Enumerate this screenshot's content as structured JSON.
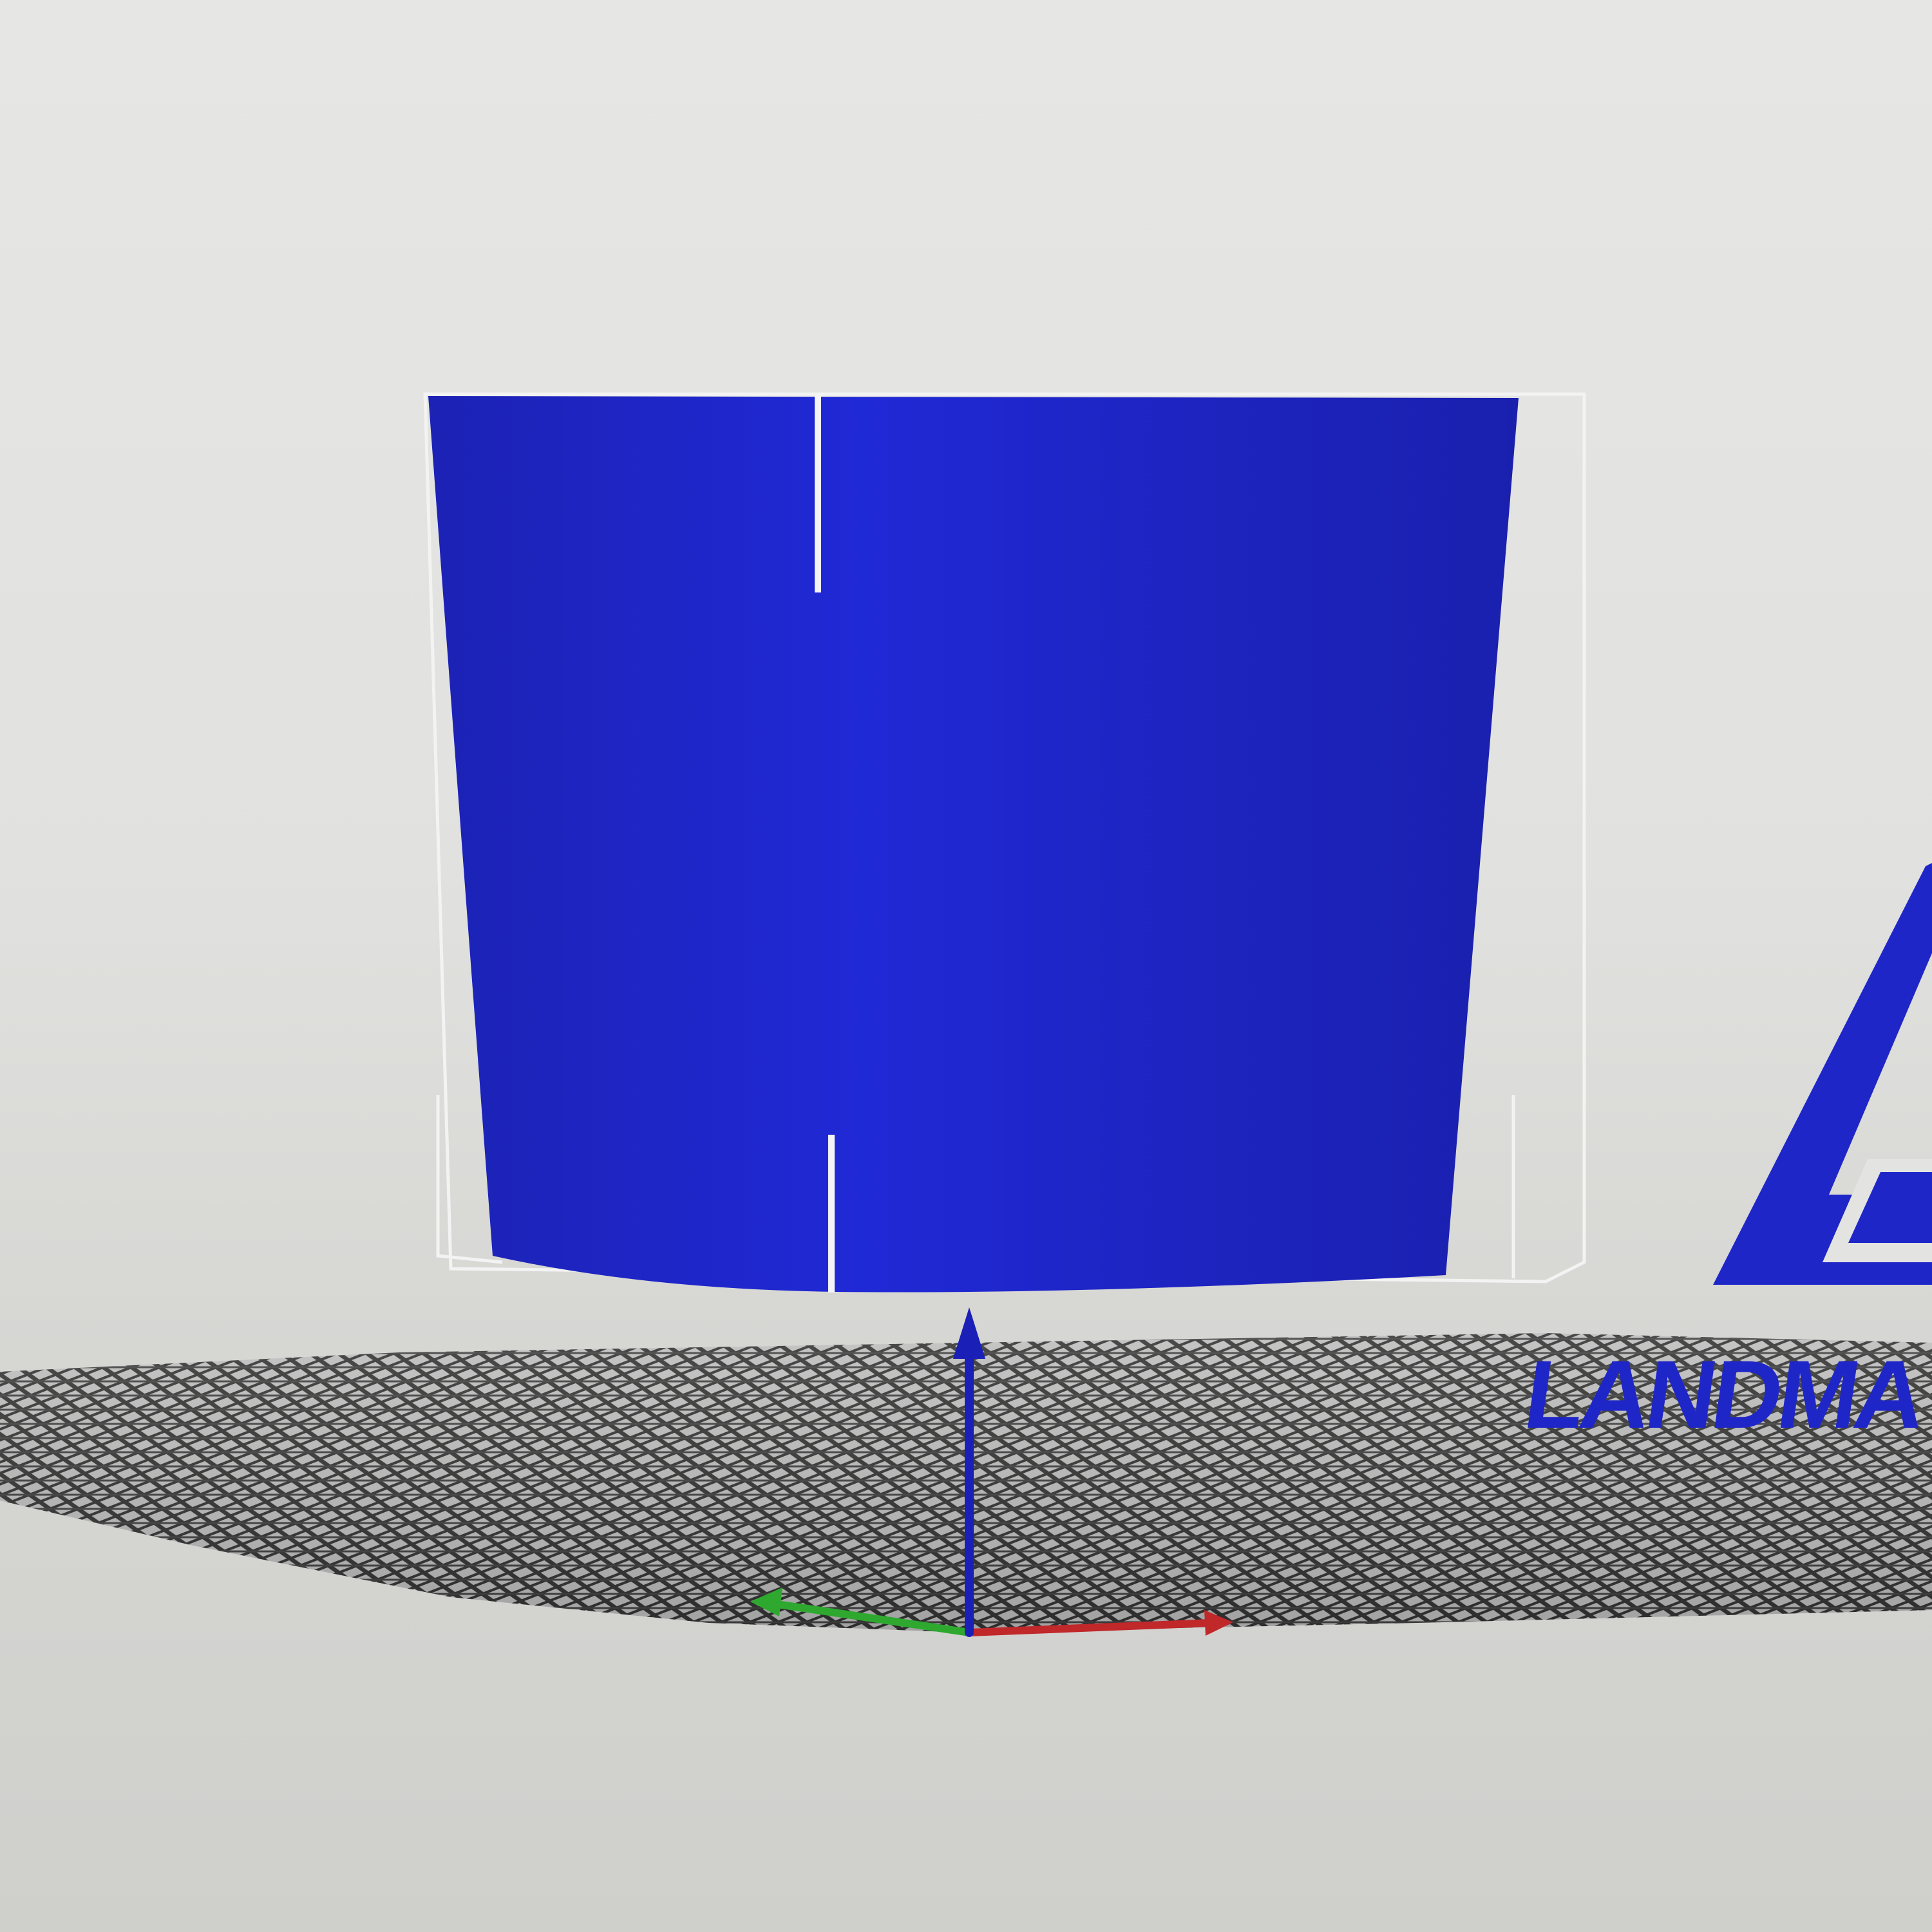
{
  "viewer": {
    "background_color": "#e3e3e1",
    "model_color": "#1f26c8",
    "slot_color": "#f4f4f6",
    "grid_color": "#2b2b2b",
    "axes": {
      "x_color": "#c0282a",
      "y_color": "#2fa82f",
      "z_color": "#1a1fb8"
    }
  },
  "logo": {
    "name": "LANDMA",
    "tagline": "",
    "subline": "",
    "color": "#1f26c8"
  }
}
